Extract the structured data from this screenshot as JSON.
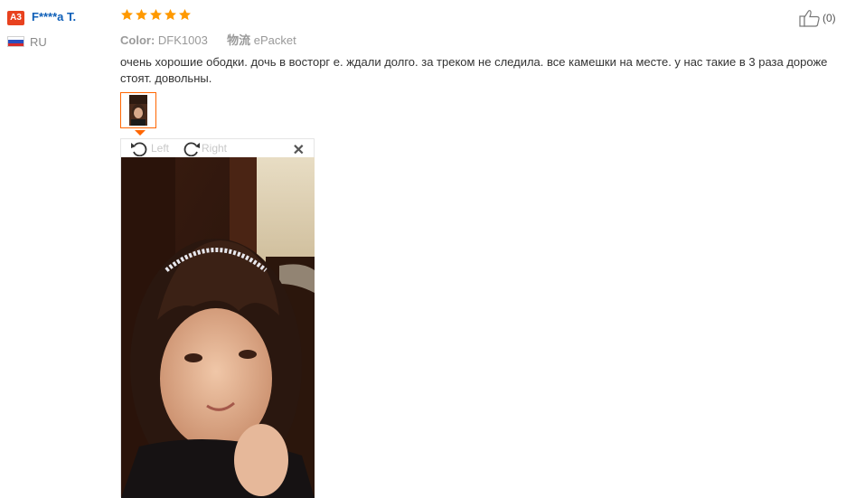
{
  "reviewer": {
    "badge": "A3",
    "name": "F****a T.",
    "country": "RU"
  },
  "rating": {
    "stars": 5,
    "max": 5,
    "color": "#ff9900"
  },
  "like": {
    "icon": "thumbs-up-icon",
    "count": "(0)"
  },
  "meta": {
    "color_label": "Color:",
    "color_value": "DFK1003",
    "shipping_label": "物流",
    "shipping_value": "ePacket"
  },
  "review_text": "очень хорошие ободки. дочь в восторг е. ждали долго. за треком не следила. все камешки на месте. у нас такие в 3 раза дороже стоят. довольны.",
  "viewer": {
    "left_label": "Left",
    "right_label": "Right",
    "close_icon": "close-icon"
  },
  "colors": {
    "name_link": "#0e5fb8",
    "accent": "#ff6600",
    "badge": "#e8421f"
  }
}
